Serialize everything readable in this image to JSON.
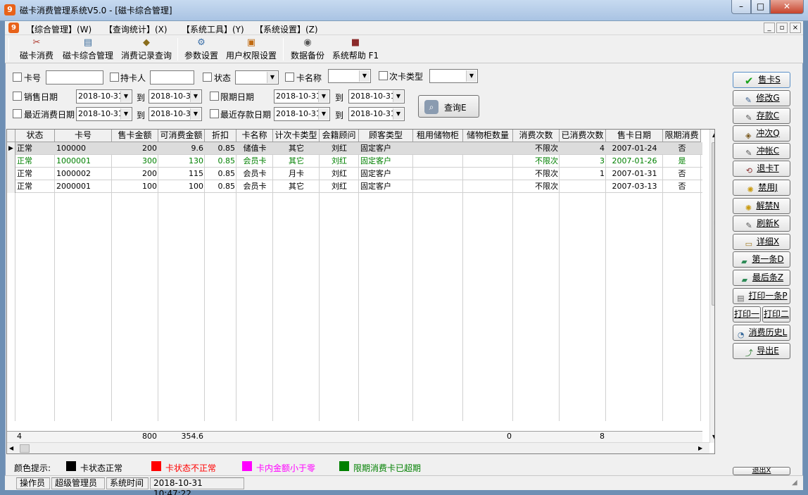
{
  "window": {
    "title": "磁卡消费管理系统V5.0 - [磁卡综合管理]",
    "icon_glyph": "9"
  },
  "menu": [
    {
      "label": "【综合管理】(W)"
    },
    {
      "label": "【查询统计】(X)"
    },
    {
      "label": "【系统工具】(Y)"
    },
    {
      "label": "【系统设置】(Z)"
    }
  ],
  "toolbar": [
    {
      "label": "磁卡消费",
      "icon": "card-consume-icon"
    },
    {
      "label": "磁卡综合管理",
      "icon": "card-manage-icon"
    },
    {
      "label": "消费记录查询",
      "icon": "record-query-icon"
    },
    {
      "label": "参数设置",
      "icon": "settings-icon"
    },
    {
      "label": "用户权限设置",
      "icon": "permission-icon"
    },
    {
      "label": "数据备份",
      "icon": "backup-icon"
    },
    {
      "label": "系统帮助 F1",
      "icon": "help-icon"
    }
  ],
  "filters": {
    "card_no": "卡号",
    "holder": "持卡人",
    "status": "状态",
    "card_name": "卡名称",
    "count_card_type": "次卡类型",
    "sale_date": "销售日期",
    "expire_date": "限期日期",
    "last_consume_date": "最近消费日期",
    "last_deposit_date": "最近存款日期",
    "to": "到",
    "date_value": "2018-10-31",
    "query_button": "查询E"
  },
  "table": {
    "columns": [
      "状态",
      "卡号",
      "售卡金额",
      "可消费金额",
      "折扣",
      "卡名称",
      "计次卡类型",
      "会籍顾问",
      "顾客类型",
      "租用储物柜",
      "储物柜数量",
      "消费次数",
      "已消费次数",
      "售卡日期",
      "限期消费"
    ],
    "rows": [
      {
        "cells": [
          "正常",
          "100000",
          "200",
          "9.6",
          "0.85",
          "储值卡",
          "其它",
          "刘红",
          "固定客户",
          "",
          "",
          "不限次",
          "4",
          "2007-01-24",
          "否"
        ],
        "color": "#000000",
        "selected": true
      },
      {
        "cells": [
          "正常",
          "1000001",
          "300",
          "130",
          "0.85",
          "会员卡",
          "其它",
          "刘红",
          "固定客户",
          "",
          "",
          "不限次",
          "3",
          "2007-01-26",
          "是"
        ],
        "color": "#008000",
        "selected": false
      },
      {
        "cells": [
          "正常",
          "1000002",
          "200",
          "115",
          "0.85",
          "会员卡",
          "月卡",
          "刘红",
          "固定客户",
          "",
          "",
          "不限次",
          "1",
          "2007-01-31",
          "否"
        ],
        "color": "#000000",
        "selected": false
      },
      {
        "cells": [
          "正常",
          "2000001",
          "100",
          "100",
          "0.85",
          "会员卡",
          "其它",
          "刘红",
          "固定客户",
          "",
          "",
          "不限次",
          "",
          "2007-03-13",
          "否"
        ],
        "color": "#000000",
        "selected": false
      }
    ],
    "footer": [
      "4",
      "",
      "800",
      "354.6",
      "",
      "",
      "",
      "",
      "",
      "",
      "0",
      "",
      "8",
      "",
      ""
    ]
  },
  "side_buttons": [
    {
      "label": "售卡S",
      "icon": "check-icon"
    },
    {
      "label": "修改G",
      "icon": "edit-icon"
    },
    {
      "label": "存款C",
      "icon": "deposit-icon"
    },
    {
      "label": "冲次Q",
      "icon": "recharge-count-icon"
    },
    {
      "label": "冲帐C",
      "icon": "reverse-icon"
    },
    {
      "label": "退卡T",
      "icon": "refund-icon"
    },
    {
      "label": "禁用J",
      "icon": "lightbulb-icon"
    },
    {
      "label": "解禁N",
      "icon": "lightbulb-icon"
    },
    {
      "label": "刷新K",
      "icon": "refresh-icon"
    },
    {
      "label": "详细X",
      "icon": "detail-icon"
    },
    {
      "label": "第一条D",
      "icon": "first-icon"
    },
    {
      "label": "最后条Z",
      "icon": "last-icon"
    },
    {
      "label": "打印一条P",
      "icon": "printer-icon"
    },
    {
      "label": "打印一",
      "icon": ""
    },
    {
      "label": "打印二",
      "icon": ""
    },
    {
      "label": "消费历史L",
      "icon": "history-icon"
    },
    {
      "label": "导出E",
      "icon": "export-icon"
    },
    {
      "label": "退出X",
      "icon": "exit-icon"
    }
  ],
  "legend": {
    "title": "颜色提示:",
    "items": [
      {
        "label": "卡状态正常",
        "color": "#000000"
      },
      {
        "label": "卡状态不正常",
        "color": "#ff0000"
      },
      {
        "label": "卡内金额小于零",
        "color": "#ff00ff"
      },
      {
        "label": "限期消费卡已超期",
        "color": "#008000"
      }
    ]
  },
  "status_bar": {
    "operator_label": "操作员",
    "operator": "超级管理员",
    "time_label": "系统时间",
    "time": "2018-10-31 10:47:22"
  },
  "accent_colors": {
    "title_bar": "#b9cfea",
    "selected_row": "#dcdcdc",
    "check_icon": "#19a31a"
  }
}
